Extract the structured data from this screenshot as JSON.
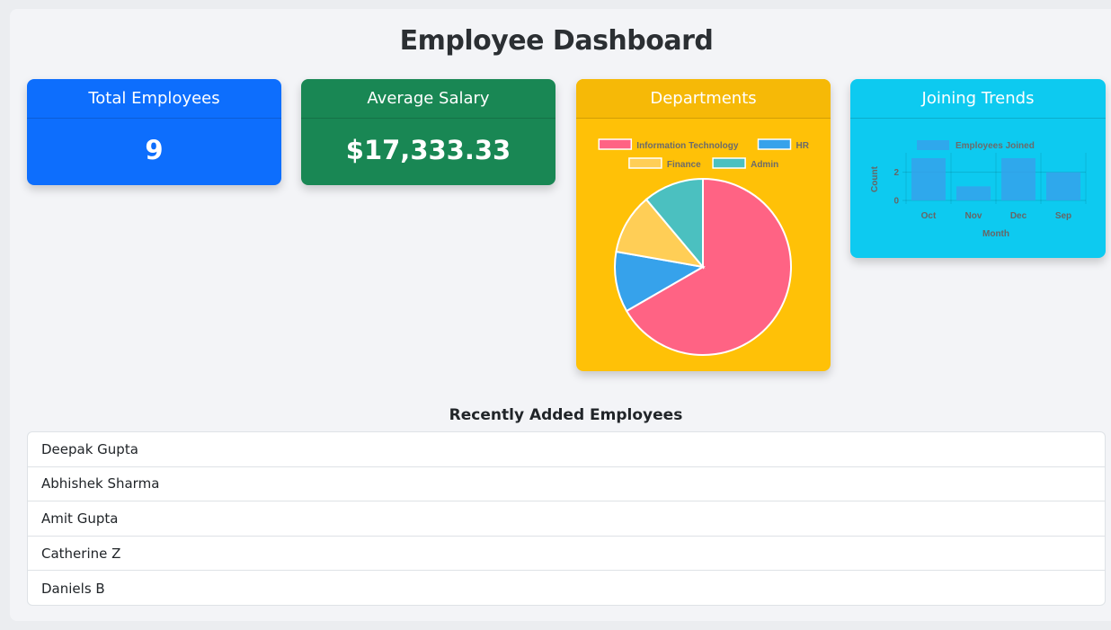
{
  "page": {
    "title": "Employee Dashboard"
  },
  "cards": {
    "total_employees": {
      "label": "Total Employees",
      "value": "9"
    },
    "average_salary": {
      "label": "Average Salary",
      "value": "$17,333.33"
    },
    "departments": {
      "label": "Departments"
    },
    "joining_trends": {
      "label": "Joining Trends"
    }
  },
  "chart_data": [
    {
      "type": "pie",
      "categories": [
        "Information Technology",
        "HR",
        "Finance",
        "Admin"
      ],
      "values": [
        6,
        1,
        1,
        1
      ],
      "colors": [
        "#ff6384",
        "#36a2eb",
        "#ffce56",
        "#4bc0c0"
      ],
      "legend": "top"
    },
    {
      "type": "bar",
      "categories": [
        "Oct",
        "Nov",
        "Dec",
        "Sep"
      ],
      "series": [
        {
          "name": "Employees Joined",
          "values": [
            3,
            1,
            3,
            2
          ]
        }
      ],
      "xlabel": "Month",
      "ylabel": "Count",
      "yticks": [
        "0",
        "2"
      ],
      "ylim": [
        0,
        3
      ],
      "legend": "top",
      "color": "#36a2eb"
    }
  ],
  "recent": {
    "title": "Recently Added Employees",
    "items": [
      "Deepak Gupta",
      "Abhishek Sharma",
      "Amit Gupta",
      "Catherine Z",
      "Daniels B"
    ]
  }
}
